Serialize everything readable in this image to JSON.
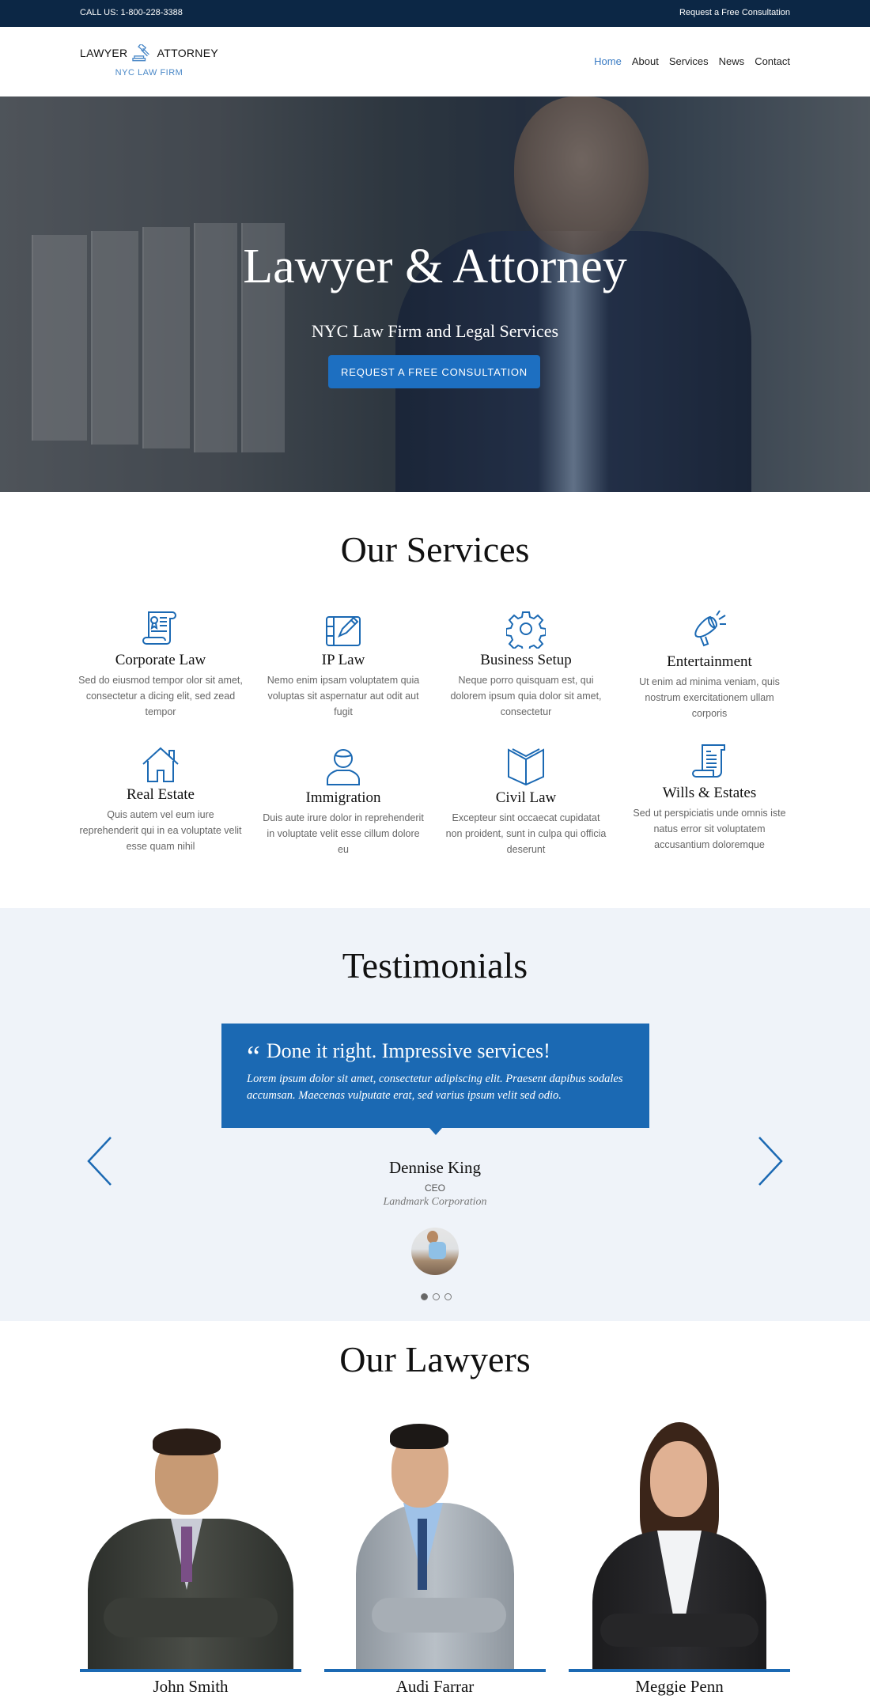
{
  "topbar": {
    "phone": "CALL US: 1-800-228-3388",
    "consult_link": "Request a Free Consultation"
  },
  "header": {
    "logo_left": "LAWYER",
    "logo_right": "ATTORNEY",
    "logo_icon": "gavel-icon",
    "logo_sub": "NYC LAW FIRM",
    "nav": [
      {
        "label": "Home",
        "active": true
      },
      {
        "label": "About",
        "active": false
      },
      {
        "label": "Services",
        "active": false
      },
      {
        "label": "News",
        "active": false
      },
      {
        "label": "Contact",
        "active": false
      }
    ]
  },
  "hero": {
    "title": "Lawyer & Attorney",
    "tagline": "NYC Law Firm and Legal Services",
    "cta": "REQUEST A FREE CONSULTATION"
  },
  "services": {
    "title": "Our Services",
    "items": [
      {
        "icon": "certificate-scroll-icon",
        "title": "Corporate Law",
        "desc": "Sed do eiusmod tempor olor sit amet, consectetur a dicing elit, sed zead tempor"
      },
      {
        "icon": "tablet-pen-icon",
        "title": "IP Law",
        "desc": "Nemo enim ipsam voluptatem quia voluptas sit aspernatur aut odit aut fugit"
      },
      {
        "icon": "gear-icon",
        "title": "Business Setup",
        "desc": "Neque porro quisquam est, qui dolorem ipsum quia dolor sit amet, consectetur"
      },
      {
        "icon": "megaphone-icon",
        "title": "Entertainment",
        "desc": "Ut enim ad minima veniam, quis nostrum exercitationem ullam corporis"
      },
      {
        "icon": "house-icon",
        "title": "Real Estate",
        "desc": "Quis autem vel eum iure reprehenderit qui in ea voluptate velit esse quam nihil"
      },
      {
        "icon": "person-icon",
        "title": "Immigration",
        "desc": "Duis aute irure dolor in reprehenderit in voluptate velit esse cillum dolore eu"
      },
      {
        "icon": "open-book-icon",
        "title": "Civil Law",
        "desc": "Excepteur sint occaecat cupidatat non proident, sunt in culpa qui officia deserunt"
      },
      {
        "icon": "document-scroll-icon",
        "title": "Wills & Estates",
        "desc": "Sed ut perspiciatis unde omnis iste natus error sit voluptatem accusantium doloremque"
      }
    ]
  },
  "testimonials": {
    "title": "Testimonials",
    "quote_mark": "“",
    "quote_title": "Done it right. Impressive services!",
    "quote_body": "Lorem ipsum dolor sit amet, consectetur adipiscing elit. Praesent dapibus sodales accumsan. Maecenas vulputate erat, sed varius ipsum velit sed odio.",
    "name": "Dennise King",
    "role": "CEO",
    "company": "Landmark Corporation",
    "slides": 3,
    "active_slide": 1
  },
  "lawyers": {
    "title": "Our Lawyers",
    "people": [
      {
        "name": "John Smith"
      },
      {
        "name": "Audi Farrar"
      },
      {
        "name": "Meggie Penn"
      }
    ]
  },
  "colors": {
    "navy": "#0c2745",
    "accent": "#1b69b3",
    "link_active": "#3b7cc4",
    "testimonial_bg": "#eff3f9"
  }
}
